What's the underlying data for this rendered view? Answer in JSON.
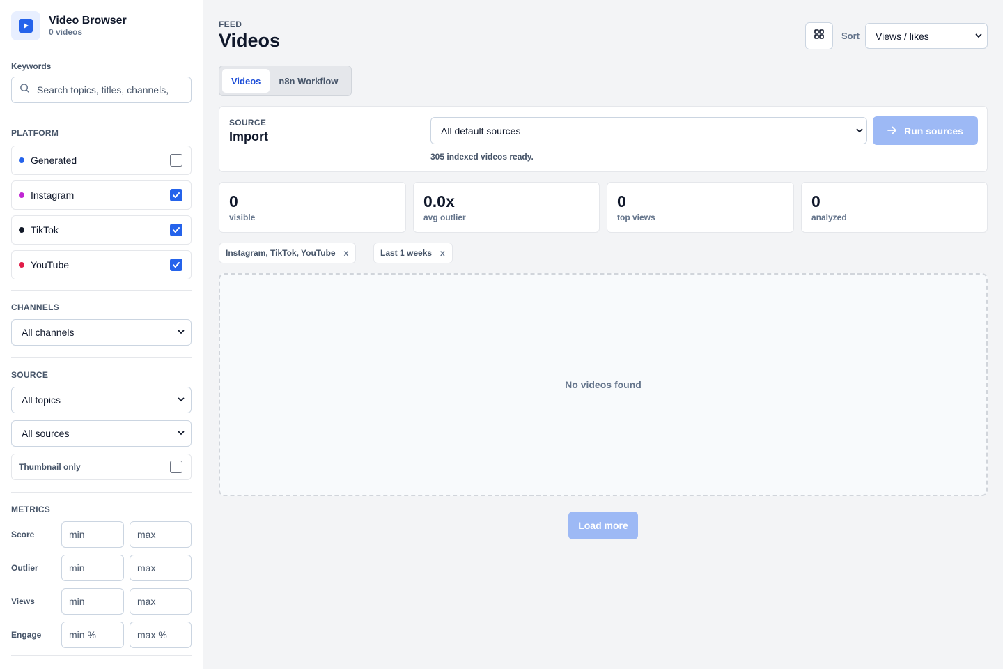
{
  "app": {
    "title": "Video Browser",
    "subtitle": "0 videos",
    "accent": "#2563eb"
  },
  "sidebar": {
    "keywords_label": "Keywords",
    "search_placeholder": "Search topics, titles, channels, ",
    "platform_title": "PLATFORM",
    "platforms": [
      {
        "name": "Generated",
        "color": "#2563eb",
        "checked": false
      },
      {
        "name": "Instagram",
        "color": "#c026d3",
        "checked": true
      },
      {
        "name": "TikTok",
        "color": "#111827",
        "checked": true
      },
      {
        "name": "YouTube",
        "color": "#e11d48",
        "checked": true
      }
    ],
    "channels_title": "CHANNELS",
    "channels_value": "All channels",
    "source_title": "SOURCE",
    "topics_value": "All topics",
    "sources_value": "All sources",
    "thumbnail_label": "Thumbnail only",
    "metrics_title": "METRICS",
    "metrics": [
      {
        "label": "Score",
        "min": "min",
        "max": "max"
      },
      {
        "label": "Outlier",
        "min": "min",
        "max": "max"
      },
      {
        "label": "Views",
        "min": "min",
        "max": "max"
      },
      {
        "label": "Engage",
        "min": "min %",
        "max": "max %"
      }
    ]
  },
  "header": {
    "eyebrow": "FEED",
    "title": "Videos",
    "grid_icon": "grid-icon",
    "sort_label": "Sort",
    "sort_value": "Views / likes"
  },
  "tabs": [
    {
      "label": "Videos",
      "active": true
    },
    {
      "label": "n8n Workflow",
      "active": false
    }
  ],
  "source_card": {
    "eyebrow": "SOURCE",
    "title": "Import",
    "select_value": "All default sources",
    "run_label": "Run sources",
    "status": "305 indexed videos ready."
  },
  "stats": [
    {
      "value": "0",
      "label": "visible"
    },
    {
      "value": "0.0x",
      "label": "avg outlier"
    },
    {
      "value": "0",
      "label": "top views"
    },
    {
      "value": "0",
      "label": "analyzed"
    }
  ],
  "chips": [
    {
      "label": "Instagram, TikTok, YouTube",
      "close": "x"
    },
    {
      "label": "Last 1 weeks",
      "close": "x"
    }
  ],
  "empty_message": "No videos found",
  "load_more_label": "Load more"
}
